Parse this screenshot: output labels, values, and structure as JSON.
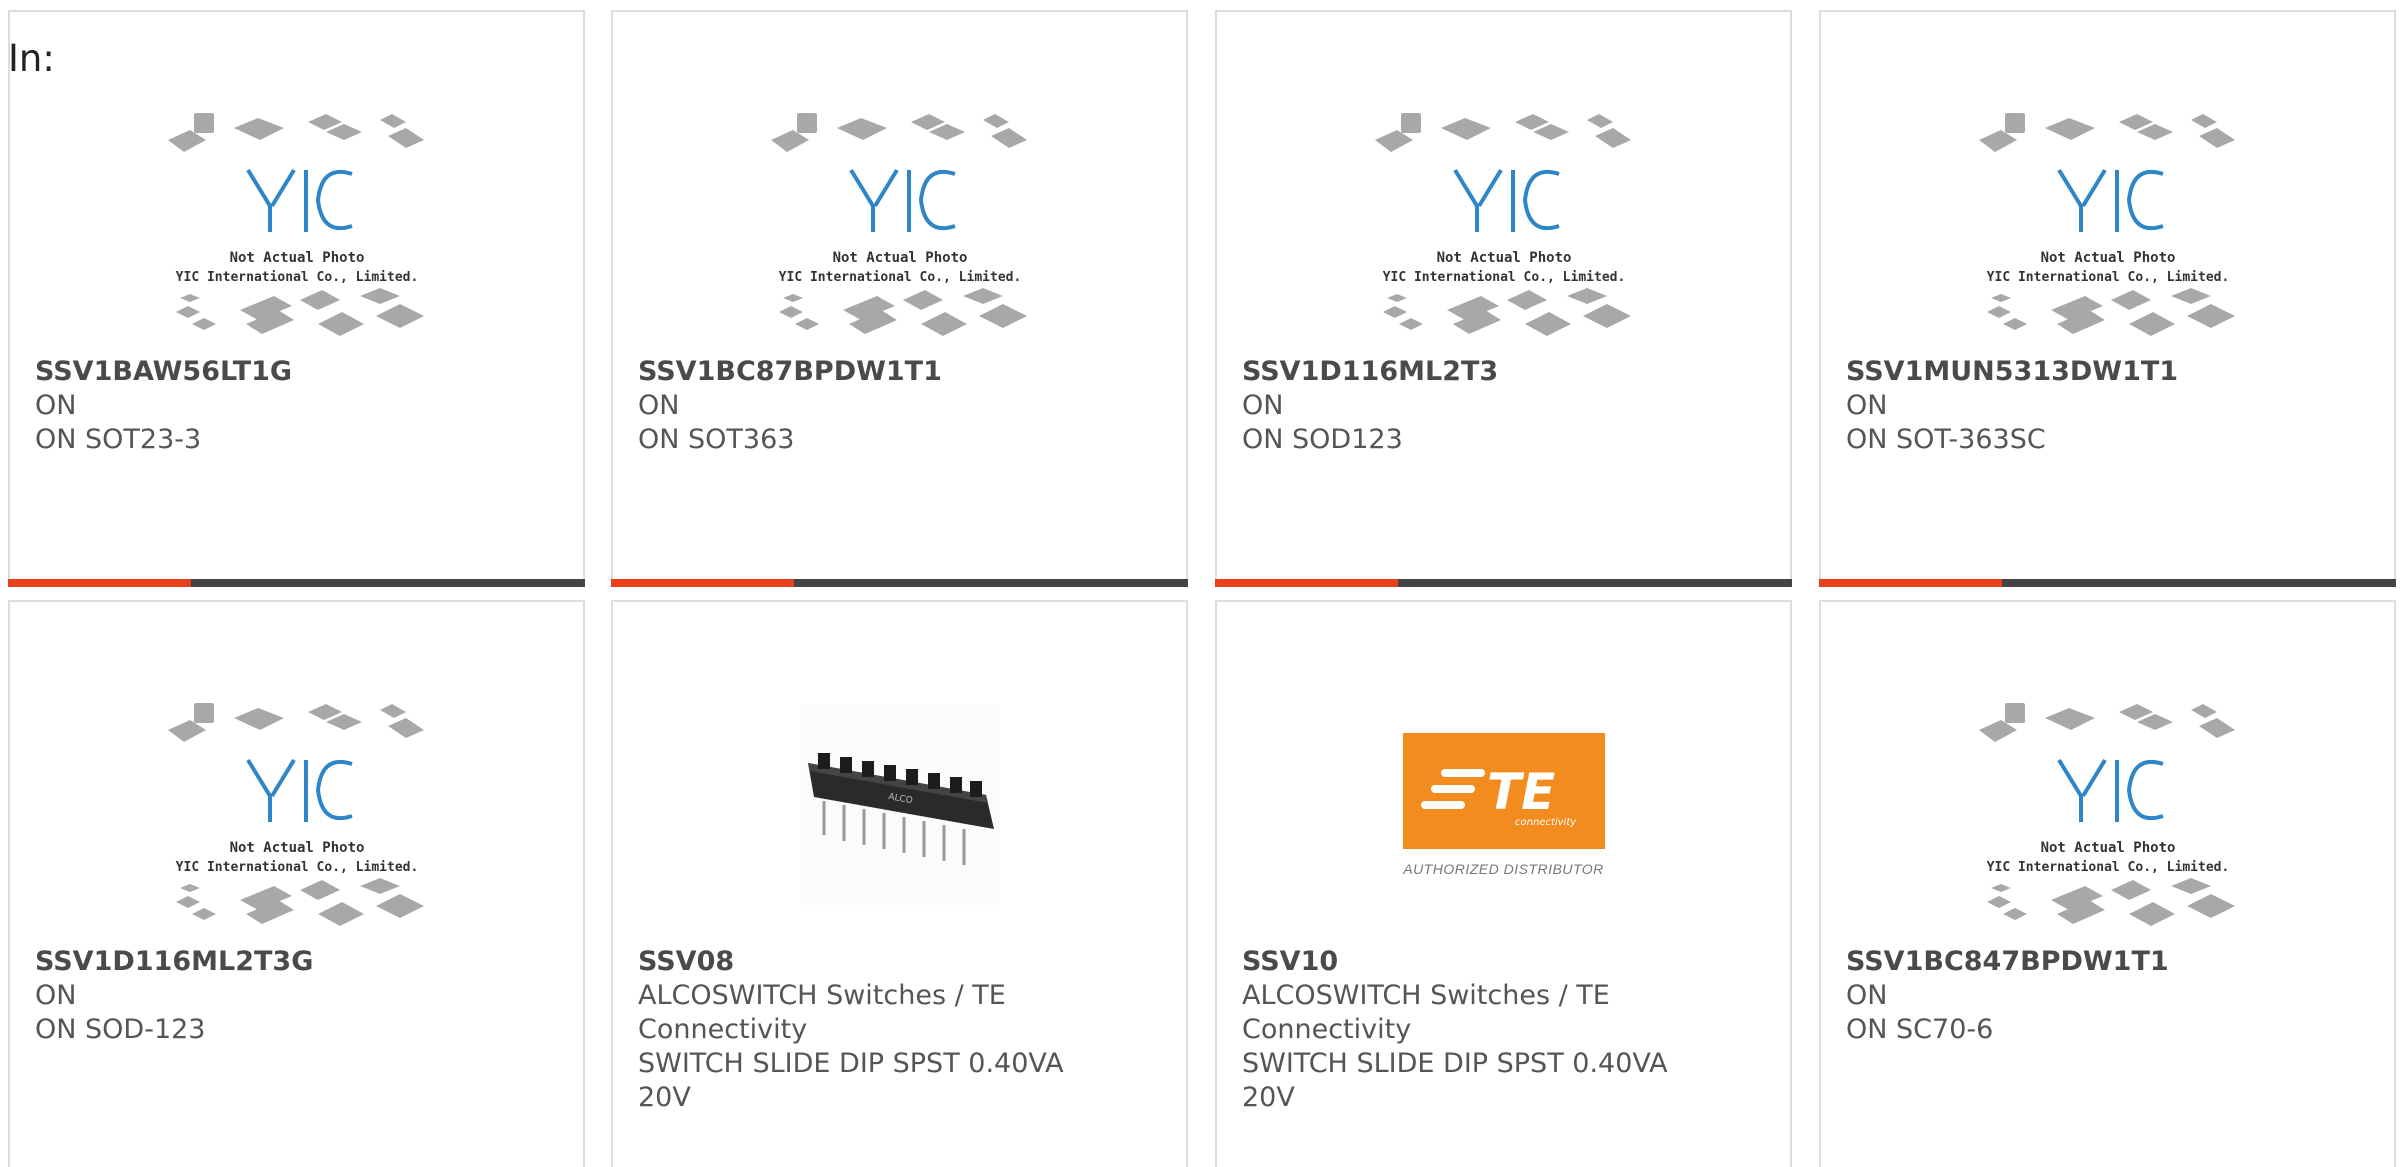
{
  "header": {
    "label": "In:"
  },
  "yic_placeholder": {
    "line1": "Not Actual Photo",
    "line2": "YIC International Co., Limited.",
    "logo_text": "YIC"
  },
  "te_logo": {
    "mark": "TE",
    "sub": "connectivity",
    "distributor": "AUTHORIZED DISTRIBUTOR"
  },
  "colors": {
    "accent": "#e8401c",
    "bar_dark": "#444444",
    "te_orange": "#f28c1e",
    "yic_blue": "#2e86c8"
  },
  "products": [
    {
      "part": "SSV1BAW56LT1G",
      "line1": "ON",
      "line2": "ON SOT23-3",
      "image": "yic-placeholder"
    },
    {
      "part": "SSV1BC87BPDW1T1",
      "line1": "ON",
      "line2": "ON SOT363",
      "image": "yic-placeholder"
    },
    {
      "part": "SSV1D116ML2T3",
      "line1": "ON",
      "line2": "ON SOD123",
      "image": "yic-placeholder"
    },
    {
      "part": "SSV1MUN5313DW1T1",
      "line1": "ON",
      "line2": "ON SOT-363SC",
      "image": "yic-placeholder"
    },
    {
      "part": "SSV1D116ML2T3G",
      "line1": "ON",
      "line2": "ON SOD-123",
      "image": "yic-placeholder"
    },
    {
      "part": "SSV08",
      "line1": "ALCOSWITCH Switches / TE Connectivity",
      "line2": "SWITCH SLIDE DIP SPST 0.40VA 20V",
      "image": "dip-switch-photo"
    },
    {
      "part": "SSV10",
      "line1": "ALCOSWITCH Switches / TE Connectivity",
      "line2": "SWITCH SLIDE DIP SPST 0.40VA 20V",
      "image": "te-connectivity-logo"
    },
    {
      "part": "SSV1BC847BPDW1T1",
      "line1": "ON",
      "line2": "ON SC70-6",
      "image": "yic-placeholder"
    }
  ]
}
